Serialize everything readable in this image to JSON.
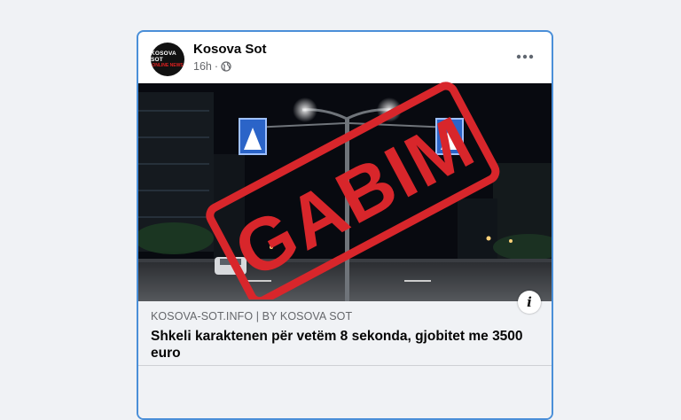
{
  "post": {
    "page_name": "Kosova Sot",
    "time": "16h",
    "separator": "·",
    "avatar_line1": "KOSOVA SOT",
    "avatar_line2": "ONLINE NEWS"
  },
  "link": {
    "source": "KOSOVA-SOT.INFO | BY KOSOVA SOT",
    "headline": "Shkeli karaktenen për vetëm 8 sekonda, gjobitet me 3500 euro"
  },
  "stamp": {
    "text": "GABIM",
    "color": "#d8262b"
  },
  "icons": {
    "privacy": "globe-icon",
    "menu": "more-options-icon",
    "info": "info-icon"
  },
  "colors": {
    "card_border": "#4a8fd8",
    "stamp_red": "#d8262b",
    "link_bg": "#f0f2f5"
  }
}
